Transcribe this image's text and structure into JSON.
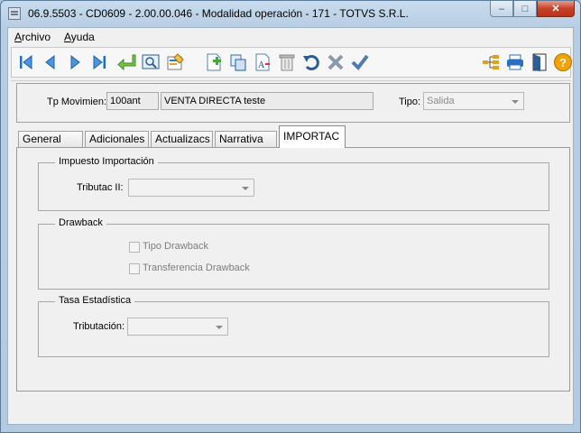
{
  "window": {
    "title": "06.9.5503 - CD0609 - 2.00.00.046 - Modalidad operación - 171 - TOTVS S.R.L.",
    "minimize": "–",
    "maximize": "□",
    "close": "✕"
  },
  "menu": [
    {
      "key": "A",
      "rest": "rchivo"
    },
    {
      "key": "A",
      "rest": "yuda"
    }
  ],
  "toolbar": {
    "left_icons": [
      "first-icon",
      "previous-icon",
      "next-icon",
      "last-icon",
      "goto-icon",
      "search-icon",
      "edit-icon",
      "new-icon",
      "copy-icon",
      "text-edit-icon",
      "delete-icon",
      "undo-icon",
      "cancel-icon",
      "confirm-icon"
    ],
    "right_icons": [
      "tree-icon",
      "print-icon",
      "exit-icon",
      "help-icon"
    ]
  },
  "header": {
    "tp_movimien_label": "Tp Movimien:",
    "tp_movimien_code": "100ant",
    "tp_movimien_desc": "VENTA  DIRECTA teste",
    "tipo_label": "Tipo:",
    "tipo_value": "Salida"
  },
  "tabs": [
    "General",
    "Adicionales",
    "Actualizacs",
    "Narrativa",
    "IMPORTAC"
  ],
  "active_tab": "IMPORTAC",
  "groups": {
    "impuesto": {
      "title": "Impuesto Importación",
      "tributac_label": "Tributac II:",
      "tributac_value": ""
    },
    "drawback": {
      "title": "Drawback",
      "tipo_drawback": "Tipo Drawback",
      "transferencia": "Transferencia Drawback"
    },
    "tasa": {
      "title": "Tasa Estadística",
      "tributacion_label": "Tributación:",
      "tributacion_value": ""
    }
  },
  "colors": {
    "accent": "#1f6fc5",
    "confirm_green": "#3d8f2a",
    "help_orange": "#f2a300"
  }
}
